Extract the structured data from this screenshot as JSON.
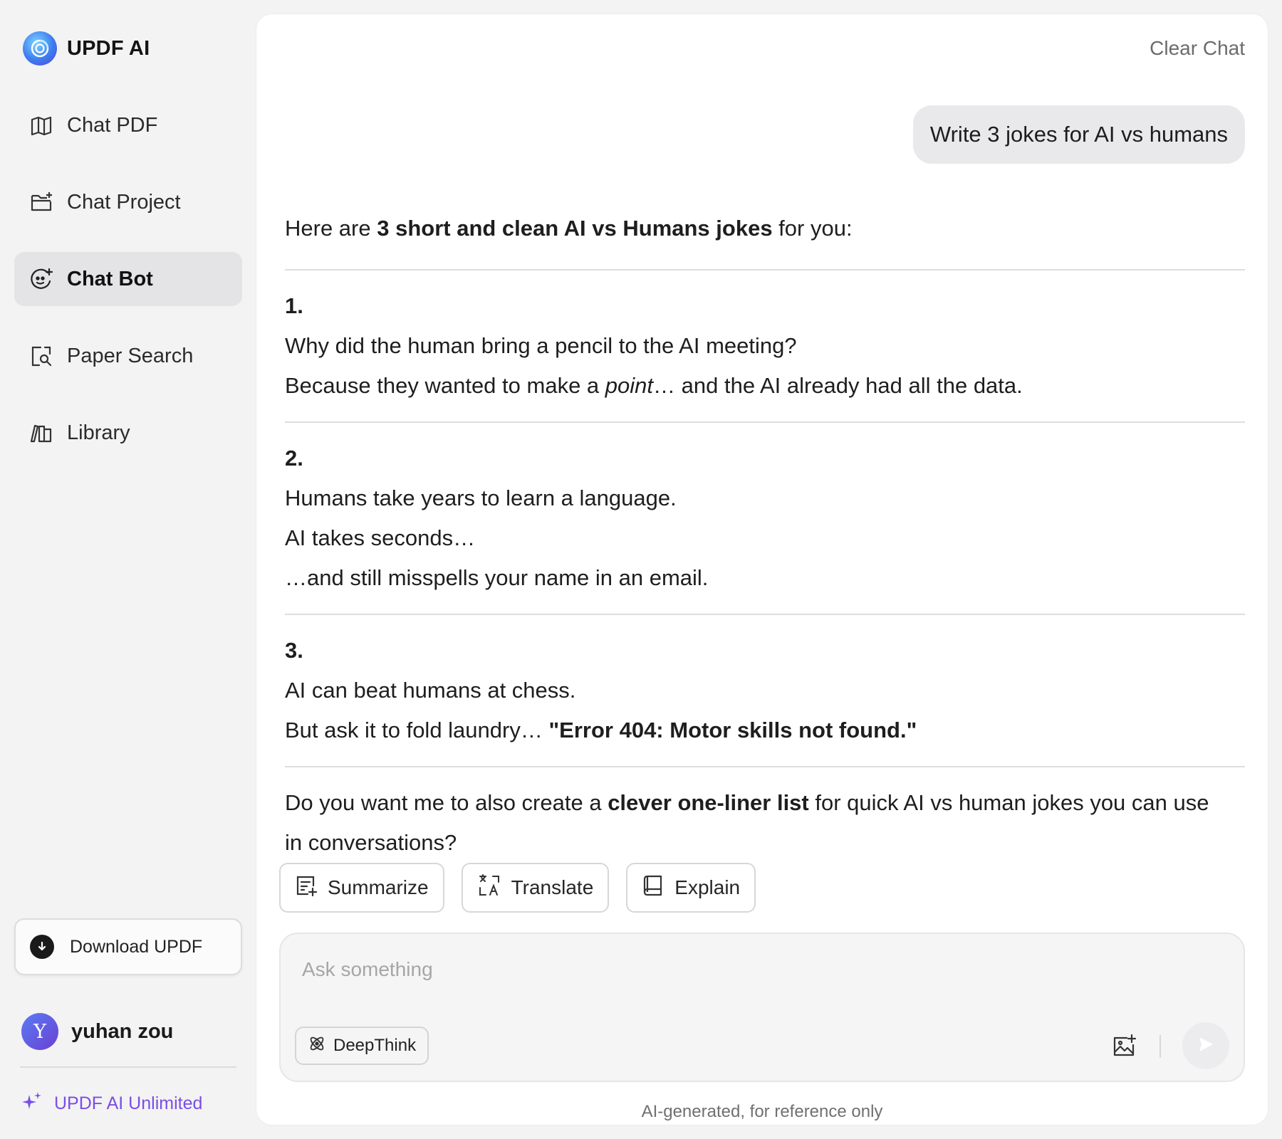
{
  "brand": {
    "name": "UPDF AI"
  },
  "sidebar": {
    "items": [
      {
        "label": "Chat PDF",
        "icon": "book-icon",
        "active": false
      },
      {
        "label": "Chat Project",
        "icon": "folder-plus-icon",
        "active": false
      },
      {
        "label": "Chat Bot",
        "icon": "bot-icon",
        "active": true
      },
      {
        "label": "Paper Search",
        "icon": "document-search-icon",
        "active": false
      },
      {
        "label": "Library",
        "icon": "library-icon",
        "active": false
      }
    ],
    "download_label": "Download UPDF",
    "user": {
      "initial": "Y",
      "name": "yuhan zou"
    },
    "unlimited_label": "UPDF AI Unlimited"
  },
  "chat": {
    "clear_label": "Clear Chat",
    "user_message": "Write 3 jokes for AI vs humans",
    "answer": {
      "intro_pre": "Here are ",
      "intro_bold": "3 short and clean AI vs Humans jokes",
      "intro_post": " for you:",
      "jokes": [
        {
          "num": "1.",
          "line1": "Why did the human bring a pencil to the AI meeting?",
          "line2_pre": "Because they wanted to make a ",
          "line2_italic": "point",
          "line2_post": "… and the AI already had all the data."
        },
        {
          "num": "2.",
          "line1": "Humans take years to learn a language.",
          "line2": "AI takes seconds…",
          "line3": "…and still misspells your name in an email."
        },
        {
          "num": "3.",
          "line1": "AI can beat humans at chess.",
          "line2_pre": "But ask it to fold laundry… ",
          "line2_bold": "\"Error 404: Motor skills not found.\""
        }
      ],
      "outro_pre": "Do you want me to also create a ",
      "outro_bold": "clever one-liner list",
      "outro_post_line1": " for quick AI vs human jokes you can use",
      "outro_line2": "in conversations?"
    },
    "quick_actions": [
      {
        "label": "Summarize",
        "icon": "summarize-icon"
      },
      {
        "label": "Translate",
        "icon": "translate-icon"
      },
      {
        "label": "Explain",
        "icon": "explain-book-icon"
      }
    ],
    "composer": {
      "placeholder": "Ask something",
      "value": "",
      "deepthink_label": "DeepThink"
    },
    "disclaimer": "AI-generated, for reference only"
  },
  "colors": {
    "accent_purple": "#7b4ee6",
    "active_nav_bg": "#e4e4e6",
    "user_bubble_bg": "#e9e9eb"
  }
}
